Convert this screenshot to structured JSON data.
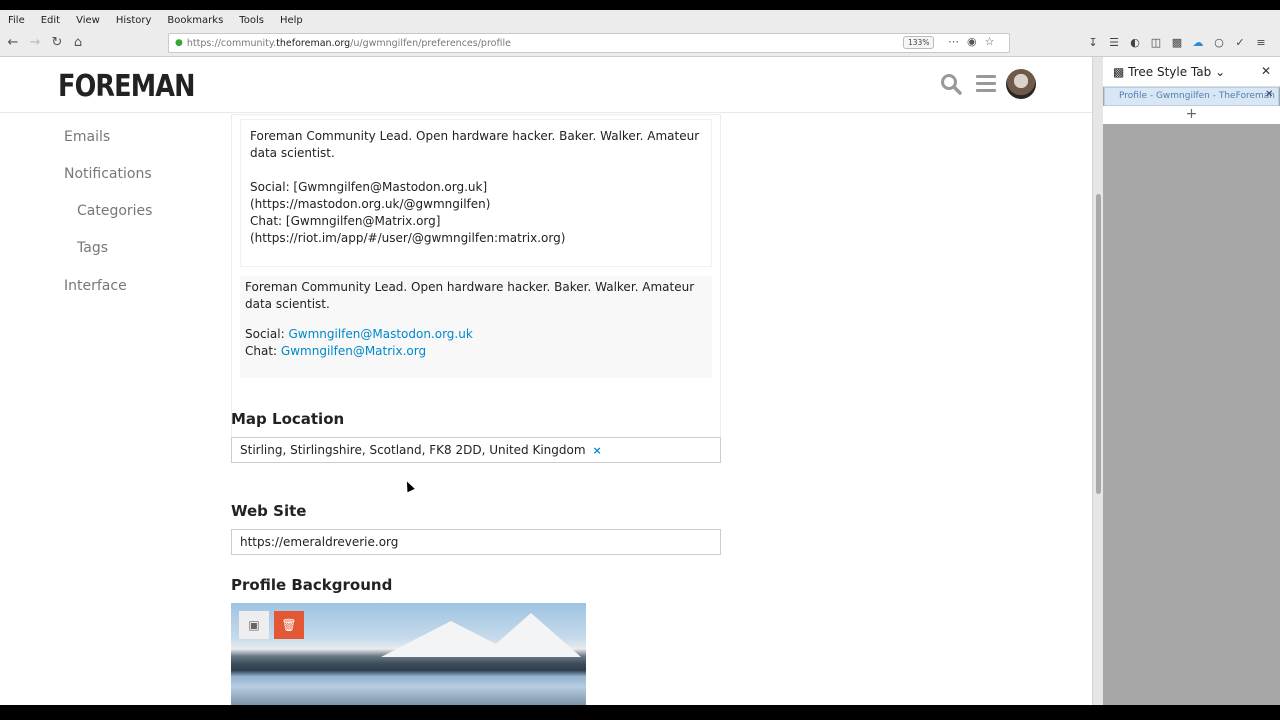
{
  "browser": {
    "menu": [
      "File",
      "Edit",
      "View",
      "History",
      "Bookmarks",
      "Tools",
      "Help"
    ],
    "url_prefix": "https://community.",
    "url_domain": "theforeman.org",
    "url_path": "/u/gwmngilfen/preferences/profile",
    "zoom": "133%"
  },
  "site": {
    "logo": "FOREMAN"
  },
  "sidebar": {
    "items": [
      {
        "label": "Emails"
      },
      {
        "label": "Notifications"
      },
      {
        "label": "Categories"
      },
      {
        "label": "Tags"
      },
      {
        "label": "Interface"
      }
    ]
  },
  "bio": {
    "raw_line1": "Foreman Community Lead. Open hardware hacker. Baker. Walker. Amateur data scientist.",
    "raw_line2": "Social: [Gwmngilfen@Mastodon.org.uk](https://mastodon.org.uk/@gwmngilfen)",
    "raw_line3": "Chat: [Gwmngilfen@Matrix.org](https://riot.im/app/#/user/@gwmngilfen:matrix.org)",
    "preview_line1": "Foreman Community Lead. Open hardware hacker. Baker. Walker. Amateur data scientist.",
    "social_label": "Social:",
    "social_link": "Gwmngilfen@Mastodon.org.uk",
    "chat_label": "Chat:",
    "chat_link": "Gwmngilfen@Matrix.org"
  },
  "map_location": {
    "title": "Map Location",
    "value": "Stirling, Stirlingshire, Scotland, FK8 2DD, United Kingdom",
    "remove_icon": "×"
  },
  "website": {
    "title": "Web Site",
    "value": "https://emeraldreverie.org"
  },
  "profile_background": {
    "title": "Profile Background"
  },
  "tree_style_tab": {
    "title": "Tree Style Tab",
    "tab_label": "Profile - Gwmngilfen - TheForeman",
    "new_tab": "+"
  }
}
